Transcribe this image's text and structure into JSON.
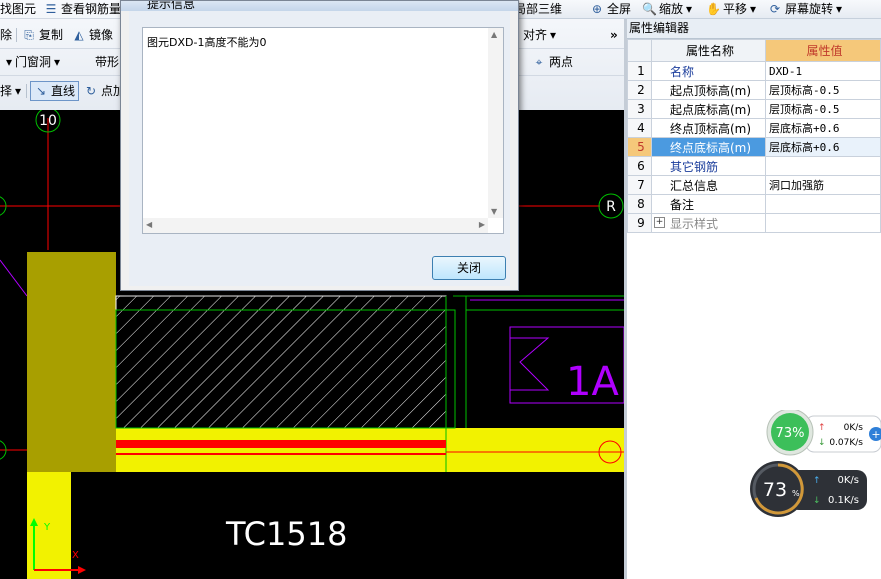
{
  "toolbar": {
    "row1": {
      "find_element": "找图元",
      "view_rebar": "查看钢筋量",
      "local_3d": "局部三维",
      "fullscreen": "全屏",
      "zoom": "缩放",
      "pan": "平移",
      "rotate_screen": "屏幕旋转"
    },
    "row2": {
      "delete_partial": "除",
      "copy": "复制",
      "mirror": "镜像",
      "align": "对齐",
      "more": "»"
    },
    "row3": {
      "door_window_opening": "门窗洞",
      "strip_opening": "带形",
      "two_points": "两点"
    },
    "row4": {
      "select_partial": "择",
      "line": "直线",
      "point_add": "点加"
    }
  },
  "dialog": {
    "title": "提示信息",
    "message": "图元DXD-1高度不能为0",
    "close_label": "关闭"
  },
  "panel": {
    "title": "属性编辑器",
    "header_name": "属性名称",
    "header_value": "属性值",
    "rows": [
      {
        "num": "1",
        "name": "名称",
        "value": "DXD-1"
      },
      {
        "num": "2",
        "name": "起点顶标高(m)",
        "value": "层顶标高-0.5"
      },
      {
        "num": "3",
        "name": "起点底标高(m)",
        "value": "层顶标高-0.5"
      },
      {
        "num": "4",
        "name": "终点顶标高(m)",
        "value": "层底标高+0.6"
      },
      {
        "num": "5",
        "name": "终点底标高(m)",
        "value": "层底标高+0.6"
      },
      {
        "num": "6",
        "name": "其它钢筋",
        "value": ""
      },
      {
        "num": "7",
        "name": "汇总信息",
        "value": "洞口加强筋"
      },
      {
        "num": "8",
        "name": "备注",
        "value": ""
      },
      {
        "num": "9",
        "name": "显示样式",
        "value": ""
      }
    ]
  },
  "canvas": {
    "axis_10": "10",
    "axis_r": "R",
    "label_1a": "1A",
    "label_tc": "TC1518",
    "axis_y": "Y",
    "axis_x": "X"
  },
  "widgets": {
    "w1_percent": "73%",
    "w1_up": "0K/s",
    "w1_down": "0.07K/s",
    "w2_percent": "73",
    "w2_percent_sign": "%",
    "w2_up": "0K/s",
    "w2_down": "0.1K/s"
  },
  "colors": {
    "canvas_bg": "#000000",
    "yellow_fill": "#f2f200",
    "olive_fill": "#a89f00",
    "red_line": "#ff0000",
    "selection_blue": "#4b9ae0",
    "header_orange": "#f5c87a"
  }
}
